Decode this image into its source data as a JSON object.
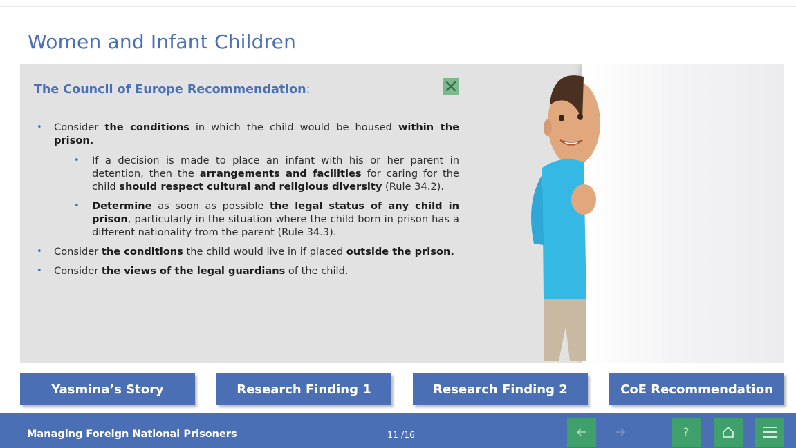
{
  "page": {
    "title": "Women and Infant Children"
  },
  "recommendation": {
    "heading": "The Council of Europe Recommendation",
    "heading_colon": ":",
    "bullets": [
      {
        "pre": "Consider ",
        "b1": "the conditions",
        "mid": " in which the child would be housed ",
        "b2": "within the prison."
      },
      {
        "pre": "Consider ",
        "b1": "the conditions",
        "mid": " the child would live in if placed ",
        "b2": "outside the prison."
      },
      {
        "pre": "Consider ",
        "b1": "the views of the legal guardians",
        "post": " of the child."
      }
    ],
    "sub_bullets": [
      {
        "t1": "If a decision is made to place an infant with his or her parent in detention, then the ",
        "b1": "arrangements and facilities",
        "t2": " for caring for the child ",
        "b2": "should respect cultural and religious diversity",
        "t3": " (Rule 34.2)."
      },
      {
        "b1": "Determine",
        "t1": " as soon as possible ",
        "b2": "the legal status of any child in prison",
        "t2": ", particularly in the situation where the child born in prison has a different nationality from the parent (Rule 34.3)."
      }
    ]
  },
  "tabs": [
    "Yasmina’s Story",
    "Research Finding 1",
    "Research Finding 2",
    "CoE Recommendation"
  ],
  "footer": {
    "course_title": "Managing Foreign National Prisoners",
    "page_counter": "11 /16"
  },
  "icons": {
    "close": "close-icon",
    "back": "arrow-left-icon",
    "forward": "arrow-right-icon",
    "help": "question-icon",
    "home": "home-icon",
    "menu": "hamburger-menu-icon"
  },
  "colors": {
    "accent": "#4a6fb4",
    "nav_green": "#40a06c",
    "close_green": "#7fb78f"
  }
}
